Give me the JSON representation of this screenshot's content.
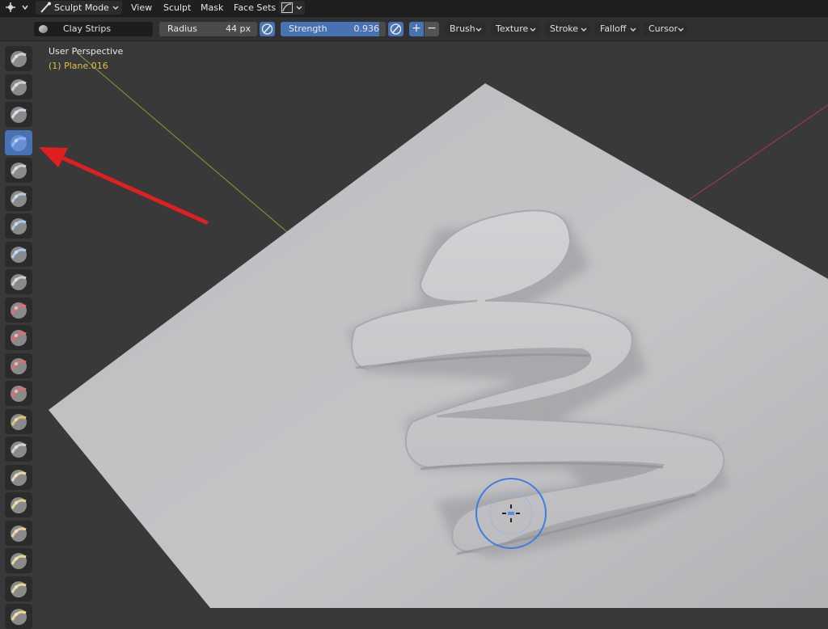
{
  "header": {
    "mode_label": "Sculpt Mode",
    "menus": [
      "View",
      "Sculpt",
      "Mask",
      "Face Sets"
    ]
  },
  "tool_settings": {
    "brush_name": "Clay Strips",
    "radius_label": "Radius",
    "radius_value": "44 px",
    "strength_label": "Strength",
    "strength_value": "0.936",
    "strength_fraction": 0.936,
    "direction_plus": "+",
    "direction_minus": "−",
    "popovers": [
      "Brush",
      "Texture",
      "Stroke",
      "Falloff",
      "Cursor"
    ]
  },
  "viewport": {
    "view_label": "User Perspective",
    "object_label": "(1) Plane.016"
  },
  "toolbar": {
    "tools": [
      {
        "icon": "draw-brush-icon"
      },
      {
        "icon": "draw-sharp-brush-icon"
      },
      {
        "icon": "clay-brush-icon"
      },
      {
        "icon": "clay-strips-brush-icon",
        "active": true
      },
      {
        "icon": "clay-thumb-brush-icon"
      },
      {
        "icon": "layer-brush-icon"
      },
      {
        "icon": "inflate-brush-icon"
      },
      {
        "icon": "blob-brush-icon"
      },
      {
        "icon": "crease-brush-icon"
      },
      {
        "icon": "smooth-brush-icon"
      },
      {
        "icon": "flatten-brush-icon"
      },
      {
        "icon": "fill-brush-icon"
      },
      {
        "icon": "scrape-brush-icon"
      },
      {
        "icon": "multiplane-scrape-brush-icon"
      },
      {
        "icon": "pinch-brush-icon"
      },
      {
        "icon": "grab-brush-icon"
      },
      {
        "icon": "elastic-deform-brush-icon"
      },
      {
        "icon": "snake-hook-brush-icon"
      },
      {
        "icon": "thumb-brush-icon"
      },
      {
        "icon": "pose-brush-icon"
      },
      {
        "icon": "nudge-brush-icon"
      }
    ]
  },
  "colors": {
    "accent": "#4772b3",
    "header_bg": "#1f1f1f",
    "toolbar_bg": "#303030",
    "viewport_bg": "#393939",
    "object_label": "#e0c040",
    "annotation_arrow": "#e02020"
  }
}
